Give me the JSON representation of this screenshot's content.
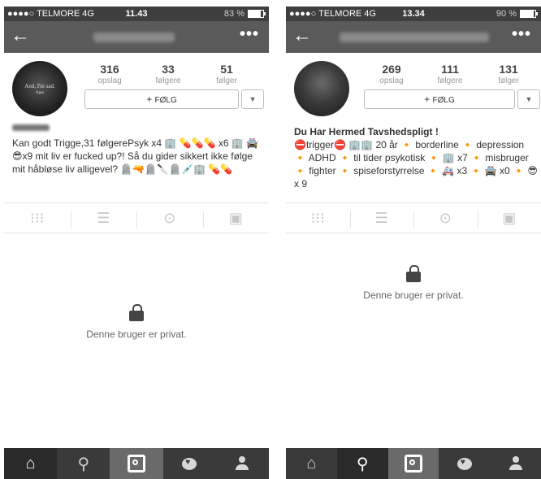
{
  "left": {
    "status": {
      "carrier": "●●●●○ TELMORE  4G",
      "time": "11.43",
      "battery_text": "83 %",
      "battery_level": 0.83
    },
    "stats": [
      {
        "num": "316",
        "label": "opslag"
      },
      {
        "num": "33",
        "label": "følgere"
      },
      {
        "num": "51",
        "label": "følger"
      }
    ],
    "avatar_text": "And, I'm sad.",
    "avatar_sub": "Ages",
    "follow_label": "FØLG",
    "bio": "Kan godt Trigge,31 følgerePsyk x4 🏢 💊💊💊 x6 🏢 🚔😎x9 mit liv er fucked up?! Så du gider sikkert ikke følge mit håbløse liv alligevel? 🪦🔫🪦🔪🪦💉🏢 💊💊",
    "private_msg": "Denne bruger er privat."
  },
  "right": {
    "status": {
      "carrier": "●●●●○ TELMORE  4G",
      "time": "13.34",
      "battery_text": "90 %",
      "battery_level": 0.9
    },
    "stats": [
      {
        "num": "269",
        "label": "opslag"
      },
      {
        "num": "111",
        "label": "følgere"
      },
      {
        "num": "131",
        "label": "følger"
      }
    ],
    "follow_label": "FØLG",
    "bio_title": "Du Har Hermed Tavshedspligt !",
    "bio": "⛔trigger⛔ 🏢🏢 20 år 🔸 borderline 🔸 depression 🔸 ADHD 🔸 til tider psykotisk 🔸 🏢 x7 🔸 misbruger 🔸 fighter 🔸 spiseforstyrrelse 🔸 🚑 x3 🔸 🚔 x0 🔸 😎 x 9",
    "private_msg": "Denne bruger er privat."
  },
  "icons": {
    "back": "←",
    "more": "•••",
    "grid": "⁝⁝⁝",
    "list": "☰",
    "location": "⊙",
    "tagged": "▣",
    "home": "⌂",
    "search": "⚲",
    "dropdown": "▼"
  }
}
